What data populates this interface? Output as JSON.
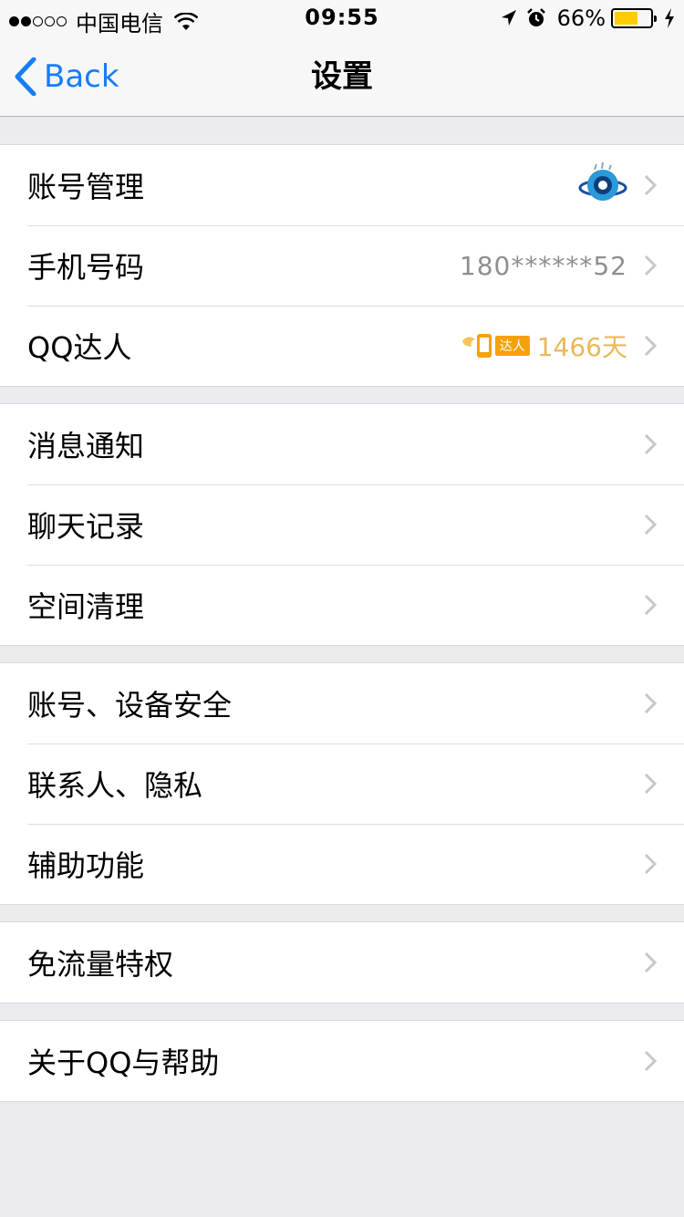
{
  "status_bar": {
    "carrier": "中国电信",
    "time": "09:55",
    "battery_percent": "66%",
    "battery_level": 0.66,
    "signal_bars_filled": 2,
    "signal_bars_total": 5
  },
  "nav": {
    "back_label": "Back",
    "title": "设置"
  },
  "groups": [
    {
      "rows": [
        {
          "label": "账号管理",
          "right_icon": "avatar-icon"
        },
        {
          "label": "手机号码",
          "value": "180******52"
        },
        {
          "label": "QQ达人",
          "badge_tag": "达人",
          "value": "1466天",
          "value_color": "#e9b85a"
        }
      ]
    },
    {
      "rows": [
        {
          "label": "消息通知"
        },
        {
          "label": "聊天记录"
        },
        {
          "label": "空间清理"
        }
      ]
    },
    {
      "rows": [
        {
          "label": "账号、设备安全"
        },
        {
          "label": "联系人、隐私"
        },
        {
          "label": "辅助功能"
        }
      ]
    },
    {
      "rows": [
        {
          "label": "免流量特权"
        }
      ]
    },
    {
      "rows": [
        {
          "label": "关于QQ与帮助"
        }
      ]
    }
  ],
  "colors": {
    "accent": "#147efb",
    "background": "#ebebf0",
    "battery": "#ffcc00",
    "gold": "#e9b85a"
  }
}
